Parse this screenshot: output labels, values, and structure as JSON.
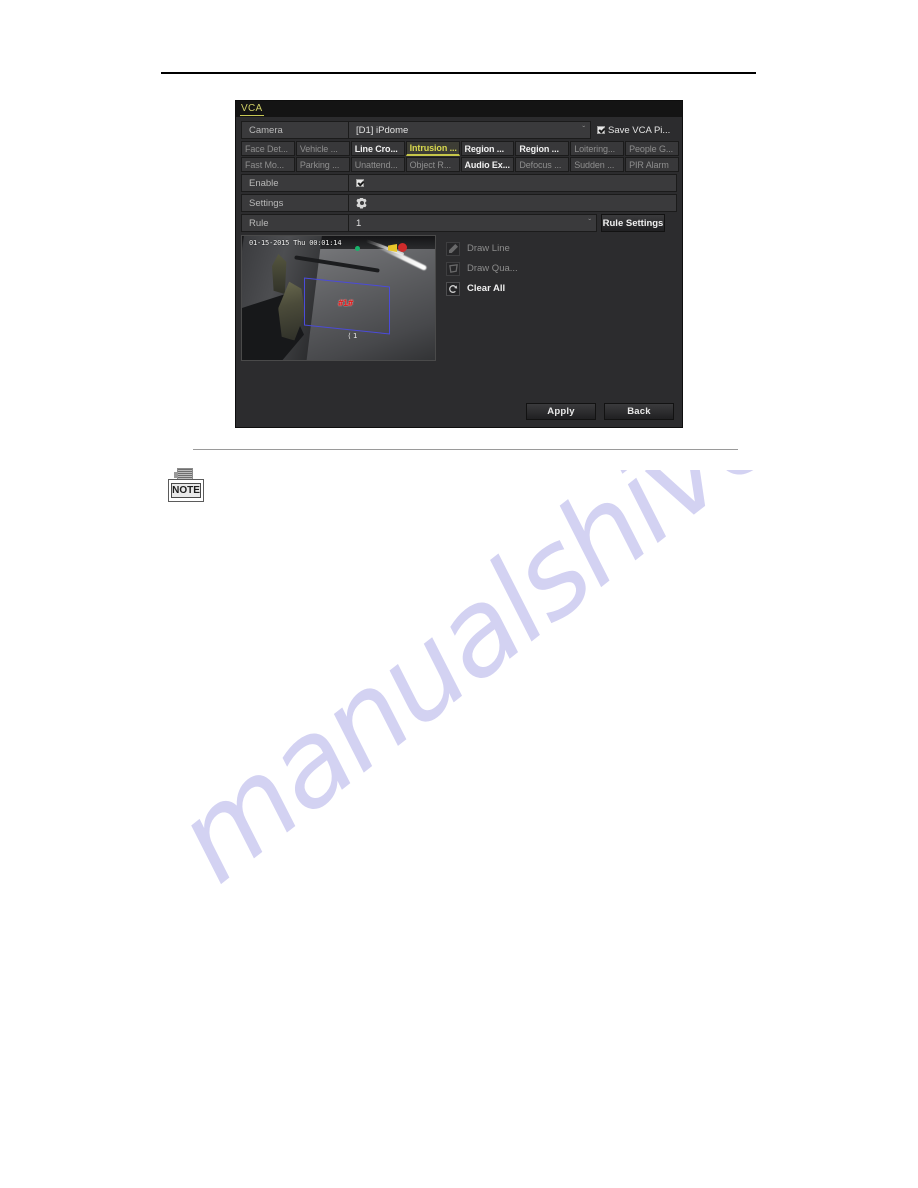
{
  "page": {
    "watermark": "manualshive.com",
    "note_icon_label": "NOTE"
  },
  "dialog": {
    "title": "VCA",
    "camera": {
      "label": "Camera",
      "value": "[D1] iPdome",
      "caret": "ˇ"
    },
    "save_vca_picture": {
      "label": "Save VCA Pi...",
      "checked": true
    },
    "tabs": [
      {
        "label": "Face Det...",
        "state": "normal"
      },
      {
        "label": "Vehicle ...",
        "state": "normal"
      },
      {
        "label": "Line Cro...",
        "state": "bold"
      },
      {
        "label": "Intrusion ...",
        "state": "active"
      },
      {
        "label": "Region ...",
        "state": "bold"
      },
      {
        "label": "Region ...",
        "state": "bold"
      },
      {
        "label": "Loitering...",
        "state": "normal"
      },
      {
        "label": "People G...",
        "state": "normal"
      },
      {
        "label": "Fast Mo...",
        "state": "normal"
      },
      {
        "label": "Parking ...",
        "state": "normal"
      },
      {
        "label": "Unattend...",
        "state": "normal"
      },
      {
        "label": "Object R...",
        "state": "normal"
      },
      {
        "label": "Audio Ex...",
        "state": "bold"
      },
      {
        "label": "Defocus ...",
        "state": "normal"
      },
      {
        "label": "Sudden ...",
        "state": "normal"
      },
      {
        "label": "PIR Alarm",
        "state": "normal"
      }
    ],
    "enable": {
      "label": "Enable",
      "checked": true
    },
    "settings": {
      "label": "Settings",
      "icon": "gear-icon"
    },
    "rule": {
      "label": "Rule",
      "value": "1",
      "caret": "ˇ",
      "button": "Rule Settings"
    },
    "preview": {
      "timestamp": "01-15-2015 Thu 00:01:14",
      "region_label": "#1#",
      "arrow_label": "⟨ 1"
    },
    "tools": [
      {
        "label": "Draw Line",
        "icon": "pencil-icon",
        "state": "disabled"
      },
      {
        "label": "Draw Qua...",
        "icon": "polygon-icon",
        "state": "disabled"
      },
      {
        "label": "Clear All",
        "icon": "clear-icon",
        "state": "enabled"
      }
    ],
    "actions": {
      "apply": "Apply",
      "back": "Back"
    }
  },
  "colors": {
    "accent_yellow": "#d8d84e",
    "dialog_bg": "#2c2c2e",
    "row_bg": "#3a3a3c",
    "region_blue": "#4b4bd9",
    "region_red": "#e02020",
    "watermark": "#d3d2f2"
  }
}
